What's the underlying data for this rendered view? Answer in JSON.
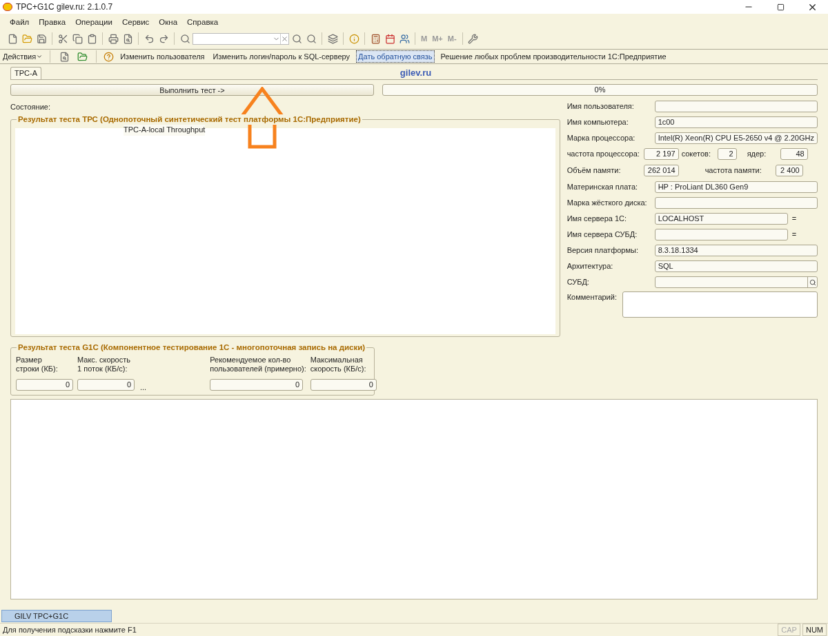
{
  "window": {
    "title": "TPC+G1C gilev.ru: 2.1.0.7"
  },
  "menu": [
    "Файл",
    "Правка",
    "Операции",
    "Сервис",
    "Окна",
    "Справка"
  ],
  "toolbar": {
    "memory_buttons": [
      "M",
      "M+",
      "M-"
    ]
  },
  "actions_bar": {
    "menu": "Действия",
    "links": [
      {
        "label": "Изменить пользователя",
        "focused": false
      },
      {
        "label": "Изменить логин/пароль к SQL-серверу",
        "focused": false
      },
      {
        "label": "Дать обратную связь",
        "focused": true
      },
      {
        "label": "Решение любых проблем производительности 1С:Предприятие",
        "focused": false
      }
    ]
  },
  "tabs": [
    {
      "label": "TPC-A",
      "selected": true
    }
  ],
  "site_label": "gilev.ru",
  "run_button": "Выполнить тест ->",
  "progress": {
    "level": 0,
    "text": "0%"
  },
  "status_label": "Состояние:",
  "tpc_group": {
    "title": "Результат теста ТРС (Однопоточный синтетический тест платформы 1С:Предприятие)",
    "chart_title": "TPC-A-local Throughput"
  },
  "g1c_group": {
    "title": "Результат теста G1C (Компонентное тестирование 1С - многопоточная запись на диски)",
    "ellipsis": "...",
    "columns": [
      {
        "label": "Размер\nстроки (КБ):",
        "value": "0"
      },
      {
        "label": "Макс. скорость\n1 поток (КБ/с):",
        "value": "0"
      },
      {
        "label": "Рекомендуемое кол-во\nпользователей (примерно):",
        "value": "0"
      },
      {
        "label": "Максимальная\nскорость (КБ/с):",
        "value": "0"
      }
    ]
  },
  "fields": [
    {
      "kind": "text",
      "label": "Имя пользователя:"
    },
    {
      "kind": "text",
      "label": "Имя компьютера:",
      "value": "1c00"
    },
    {
      "kind": "text",
      "label": "Марка процессора:",
      "value": "Intel(R) Xeon(R) CPU E5-2650 v4 @ 2.20GHz"
    },
    {
      "kind": "triple",
      "items": [
        {
          "label": "частота процессора:",
          "value": "2 197"
        },
        {
          "label": "сокетов:",
          "value": "2"
        },
        {
          "label": "ядер:",
          "value": "48"
        }
      ]
    },
    {
      "kind": "pair",
      "items": [
        {
          "label": "Объём памяти:",
          "value": "262 014"
        },
        {
          "label": "частота памяти:",
          "value": "2 400"
        }
      ]
    },
    {
      "kind": "text",
      "label": "Материнская плата:",
      "value": "HP : ProLiant DL360 Gen9"
    },
    {
      "kind": "text",
      "label": "Марка жёсткого диска:"
    },
    {
      "kind": "eq",
      "label": "Имя сервера 1С:",
      "value": "LOCALHOST",
      "suffix": "="
    },
    {
      "kind": "eq",
      "label": "Имя сервера СУБД:",
      "suffix": "="
    },
    {
      "kind": "text",
      "label": "Версия платформы:",
      "value": "8.3.18.1334"
    },
    {
      "kind": "text",
      "label": "Архитектура:",
      "value": "SQL"
    },
    {
      "kind": "search",
      "label": "СУБД:"
    },
    {
      "kind": "memo",
      "label": "Комментарий:"
    }
  ],
  "taskbar": [
    {
      "label": "GILV TPC+G1C",
      "selected": true
    }
  ],
  "status_bar": {
    "hint": "Для получения подсказки нажмите F1",
    "indicators": [
      {
        "label": "CAP",
        "on": false
      },
      {
        "label": "NUM",
        "on": true
      }
    ]
  }
}
